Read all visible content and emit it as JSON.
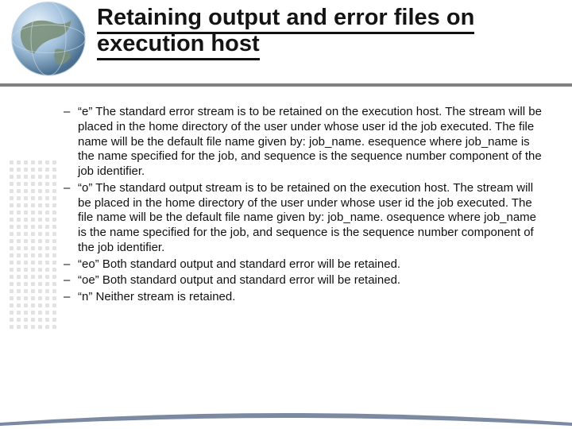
{
  "title": "Retaining output and error files on execution host",
  "bullets": [
    "“e” The standard error stream is to be retained on the execution host. The stream will be placed in the home directory of the user under whose user id the job executed. The file name will be the default file name given by: job_name. esequence where job_name is the name specified for the job, and sequence is the sequence number component of the job identifier.",
    "“o” The standard output stream is to be retained on the execution host. The stream will be placed in the home directory of the user under whose user id the job executed. The file name will be the default file name given by: job_name. osequence where job_name is the name specified for the job, and sequence is the sequence number component of the job identifier.",
    "“eo” Both standard output and standard error will be retained.",
    "“oe” Both standard output and standard error will be retained.",
    "“n” Neither stream is retained."
  ],
  "dash": "–"
}
